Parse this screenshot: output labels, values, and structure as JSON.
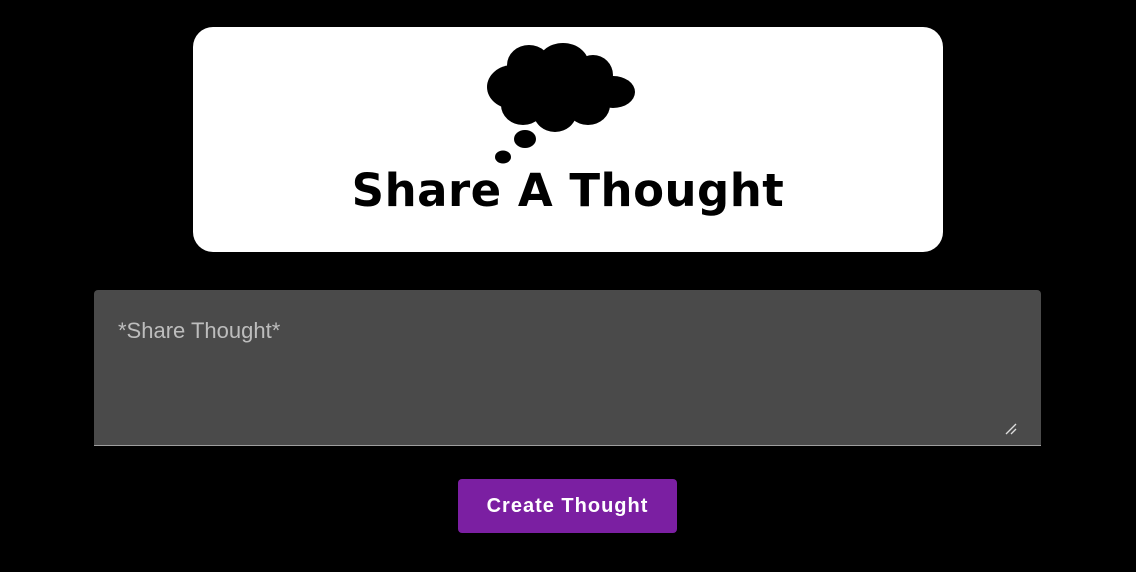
{
  "logo": {
    "title": "Share A Thought",
    "icon": "thought-cloud-icon"
  },
  "thought_form": {
    "value": "",
    "placeholder": "*Share Thought*",
    "resize_icon": "resize-handle-icon"
  },
  "actions": {
    "create_label": "Create Thought"
  },
  "colors": {
    "background": "#000000",
    "logo_card": "#ffffff",
    "input_background": "#4a4a4a",
    "button": "#7b1fa2",
    "button_text": "#ffffff"
  }
}
